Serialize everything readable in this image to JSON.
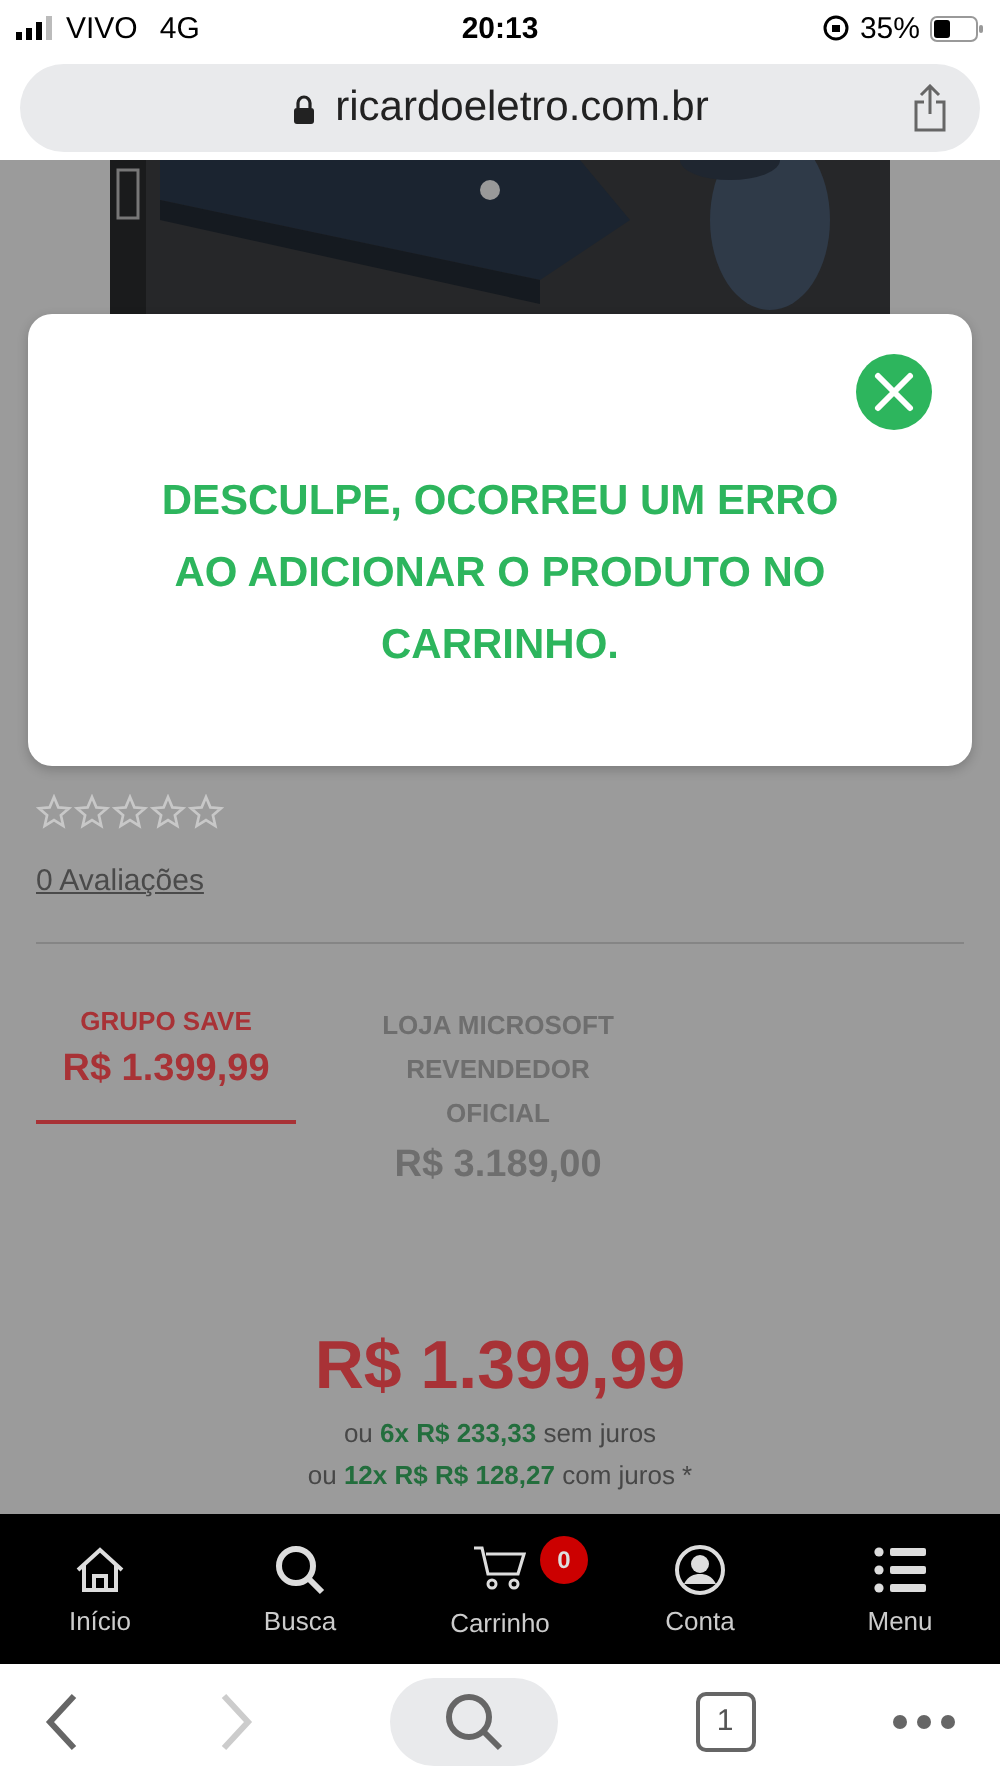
{
  "status_bar": {
    "carrier": "VIVO",
    "network": "4G",
    "time": "20:13",
    "battery": "35%"
  },
  "address_bar": {
    "url": "ricardoeletro.com.br"
  },
  "product": {
    "stars": 0,
    "reviews_link": "0 Avaliações"
  },
  "error_dialog": {
    "message": "DESCULPE, OCORREU UM ERRO AO ADICIONAR O PRODUTO NO CARRINHO."
  },
  "sellers": [
    {
      "name": "GRUPO SAVE",
      "price": "R$ 1.399,99",
      "selected": true
    },
    {
      "name": "LOJA MICROSOFT REVENDEDOR OFICIAL",
      "price": "R$ 3.189,00",
      "selected": false
    }
  ],
  "price": {
    "main": "R$ 1.399,99",
    "installments": [
      "ou **6x R$ 233,33** sem juros",
      "ou **12x R$ R$ 128,27** com juros *"
    ]
  },
  "bottom_nav": [
    {
      "kind": "home",
      "label": "Início"
    },
    {
      "kind": "search",
      "label": "Busca"
    },
    {
      "kind": "cart",
      "label": "Carrinho",
      "badge": "0"
    },
    {
      "kind": "account",
      "label": "Conta"
    },
    {
      "kind": "menu",
      "label": "Menu"
    }
  ],
  "browser_toolbar": {
    "tab_count": "1",
    "forward_disabled": true
  }
}
